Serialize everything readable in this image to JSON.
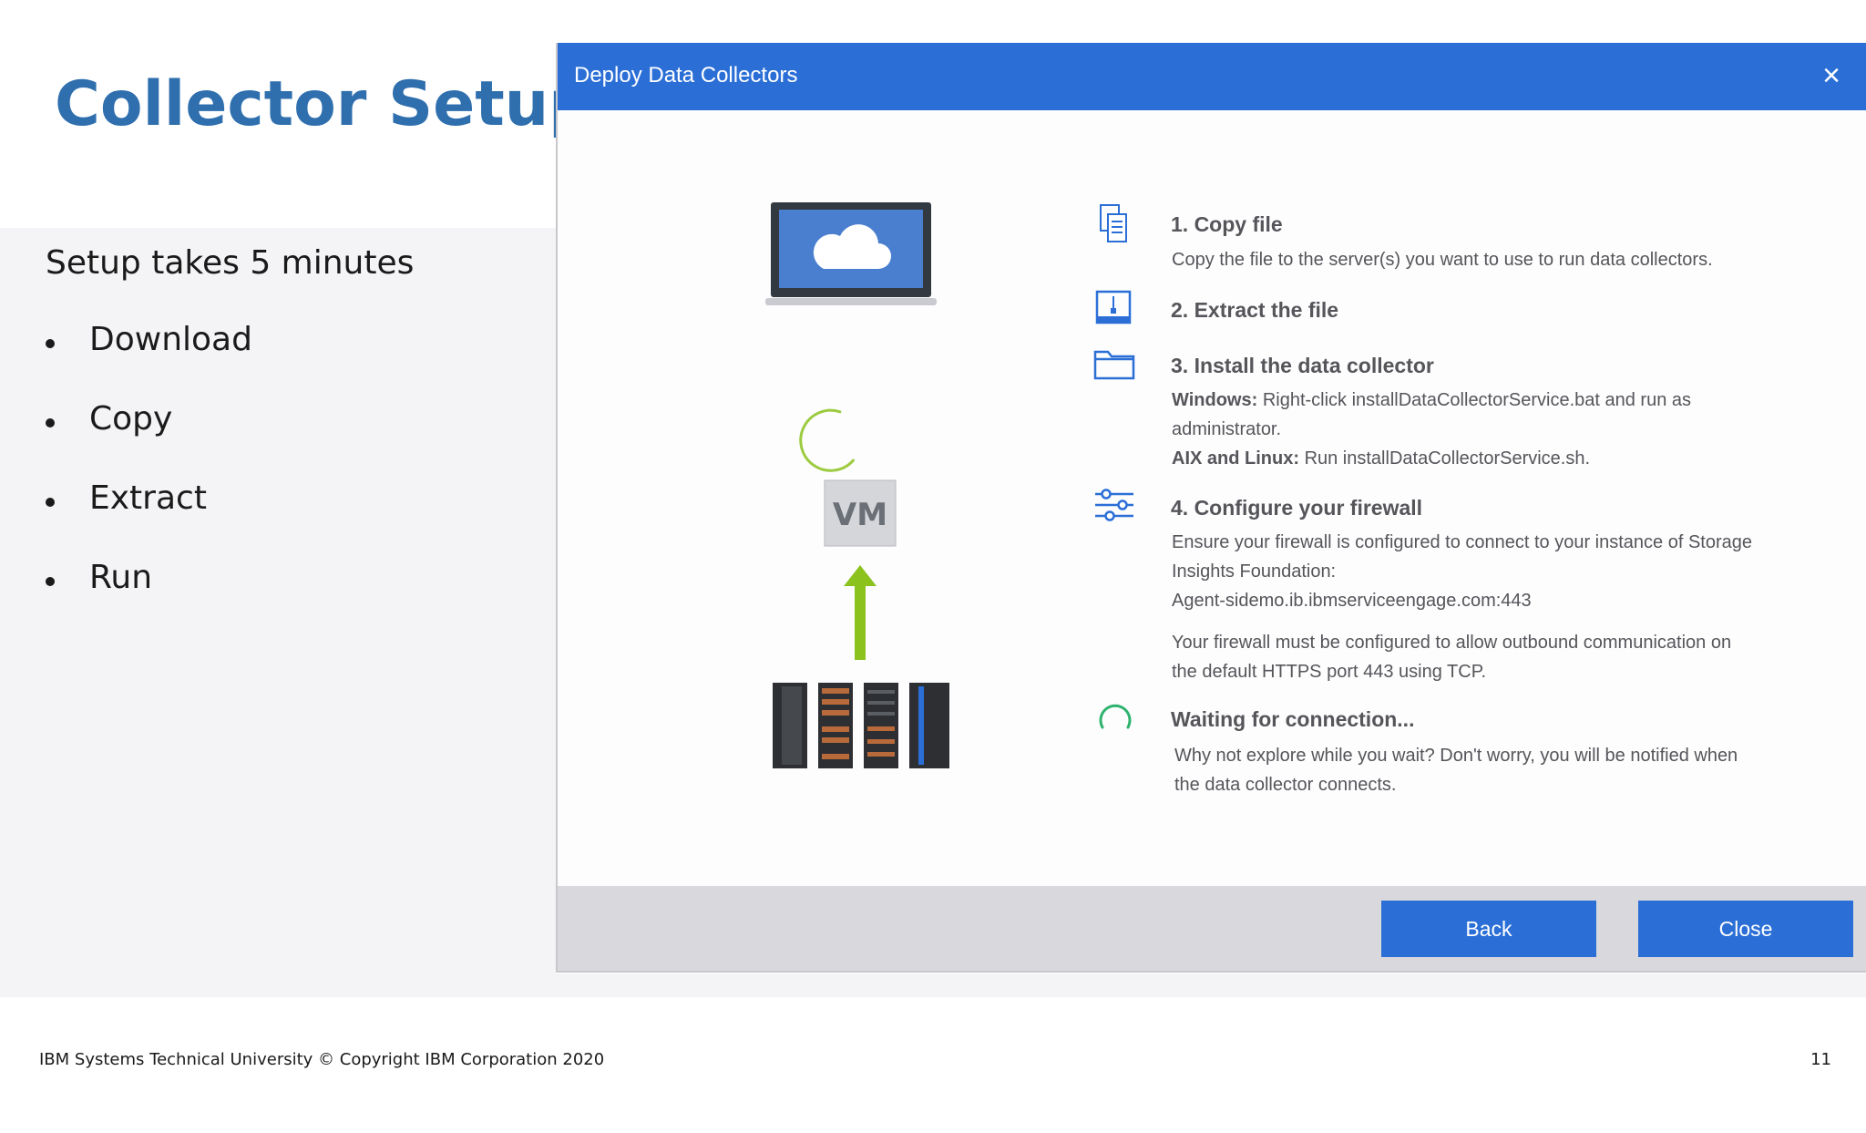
{
  "slide": {
    "title": "Collector Setup",
    "subtitle": "Setup takes 5 minutes",
    "bullets": [
      "Download",
      "Copy",
      "Extract",
      "Run"
    ],
    "footer_left": "IBM Systems Technical University  © Copyright IBM Corporation 2020",
    "page_number": "11"
  },
  "dialog": {
    "title": "Deploy Data Collectors",
    "close_icon": "×",
    "vm_label": "VM",
    "steps": [
      {
        "icon": "copy-file-icon",
        "title": "1. Copy file",
        "text": "Copy the file to the server(s) you want to use to run data collectors."
      },
      {
        "icon": "extract-icon",
        "title": "2. Extract the file"
      },
      {
        "icon": "folder-icon",
        "title": "3. Install the data collector",
        "windows_label": "Windows:",
        "windows_text": "Right-click installDataCollectorService.bat and run as",
        "windows_text2": "administrator.",
        "aix_label": "AIX and Linux:",
        "aix_text": "Run installDataCollectorService.sh."
      },
      {
        "icon": "sliders-icon",
        "title": "4. Configure your firewall",
        "text1": "Ensure your firewall is configured to connect to your instance of Storage",
        "text2": "Insights Foundation:",
        "host": "Agent-sidemo.ib.ibmserviceengage.com:443",
        "text3": "Your firewall must be configured to allow outbound communication on",
        "text4": "the default HTTPS port 443 using TCP."
      }
    ],
    "waiting": {
      "title": "Waiting for connection...",
      "text1": "Why not explore while you wait? Don't worry, you will be notified when",
      "text2": "the data collector connects."
    },
    "buttons": {
      "back": "Back",
      "close": "Close"
    },
    "colors": {
      "header": "#2b6fd6",
      "button": "#2b6fd6",
      "arrow": "#8cc21e",
      "spinner": "#2fb36e"
    }
  }
}
